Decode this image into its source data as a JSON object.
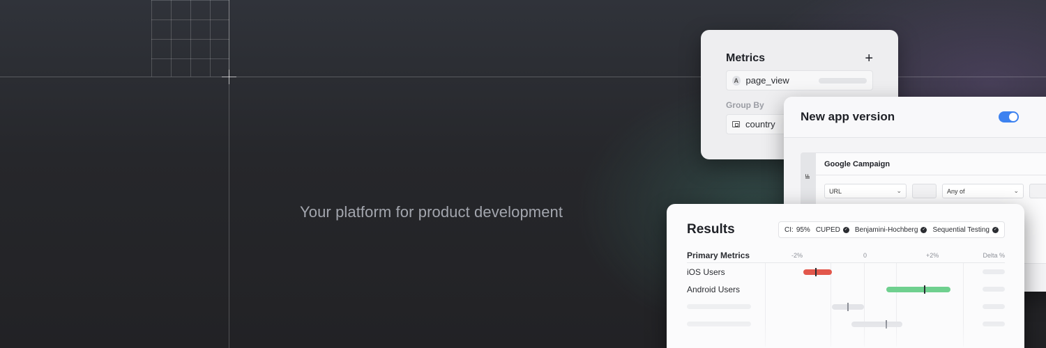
{
  "tagline": "Your platform for product development",
  "metrics_card": {
    "title": "Metrics",
    "add_icon": "plus-icon",
    "metric": {
      "badge": "A",
      "name": "page_view"
    },
    "group_by_label": "Group By",
    "group_by": {
      "icon": "folder-icon",
      "name": "country"
    }
  },
  "version_card": {
    "title": "New app version",
    "toggle_on": true,
    "if_label": "IF",
    "condition_title": "Google Campaign",
    "conditions": [
      {
        "field": "URL",
        "operator": "Any of"
      }
    ]
  },
  "results_card": {
    "title": "Results",
    "settings": [
      {
        "label": "CI:",
        "value": "95%"
      },
      {
        "label": "CUPED",
        "checked": true
      },
      {
        "label": "Benjamini-Hochberg",
        "checked": true
      },
      {
        "label": "Sequential Testing",
        "checked": true
      }
    ],
    "primary_metrics_label": "Primary Metrics",
    "axis_ticks": [
      "-2%",
      "0",
      "+2%"
    ],
    "delta_label": "Delta %",
    "rows": [
      {
        "label": "iOS Users",
        "ci_low": -1.9,
        "ci_high": -1.0,
        "estimate": -1.5,
        "color": "#e2574c"
      },
      {
        "label": "Android Users",
        "ci_low": 0.7,
        "ci_high": 2.7,
        "estimate": 1.9,
        "color": "#6fd08f"
      },
      {
        "label": "",
        "ci_low": -1.0,
        "ci_high": 0.0,
        "estimate": -0.5,
        "color": "#e3e4e8"
      },
      {
        "label": "",
        "ci_low": -0.4,
        "ci_high": 1.2,
        "estimate": 0.7,
        "color": "#e3e4e8"
      }
    ]
  }
}
